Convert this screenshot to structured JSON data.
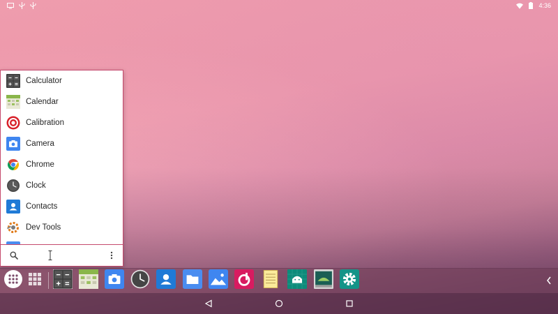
{
  "status_bar": {
    "time": "4:36",
    "left_icons": [
      "screen-mirror-icon",
      "usb-icon",
      "usb-icon"
    ],
    "right_icons": [
      "wifi-icon",
      "battery-icon"
    ]
  },
  "app_drawer": {
    "items": [
      {
        "label": "Calculator",
        "icon": "calculator-icon"
      },
      {
        "label": "Calendar",
        "icon": "calendar-icon"
      },
      {
        "label": "Calibration",
        "icon": "calibration-icon"
      },
      {
        "label": "Camera",
        "icon": "camera-icon"
      },
      {
        "label": "Chrome",
        "icon": "chrome-icon"
      },
      {
        "label": "Clock",
        "icon": "clock-icon"
      },
      {
        "label": "Contacts",
        "icon": "contacts-icon"
      },
      {
        "label": "Dev Tools",
        "icon": "dev-tools-icon"
      }
    ],
    "search_placeholder": "",
    "search_icon": "search-icon",
    "menu_icon": "overflow-menu-icon"
  },
  "taskbar": {
    "start_icon": "app-drawer-dots-icon",
    "grid_icon": "recent-apps-grid-icon",
    "pinned": [
      "calculator-icon",
      "calendar-icon",
      "camera-icon",
      "clock-icon",
      "contacts-icon",
      "files-icon",
      "gallery-icon",
      "music-icon",
      "notes-icon",
      "android-icon",
      "dev-tools-icon",
      "settings-icon"
    ],
    "collapse_icon": "chevron-left-icon"
  },
  "nav_bar": {
    "buttons": [
      "back-icon",
      "home-icon",
      "overview-icon"
    ]
  },
  "colors": {
    "drawer_border": "#c54a6d",
    "camera_blue": "#3f86f0",
    "settings_teal": "#139488"
  }
}
